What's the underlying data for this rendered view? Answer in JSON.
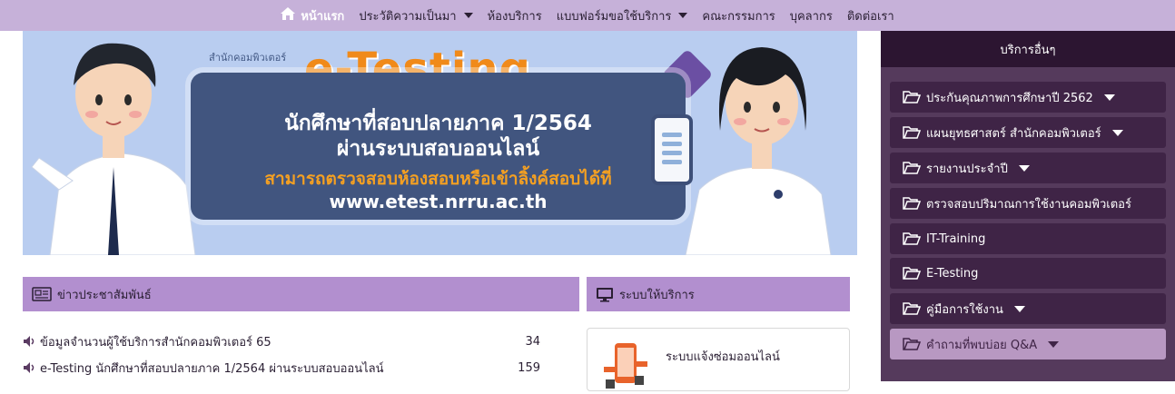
{
  "topnav": {
    "items": [
      {
        "label": "หน้าแรก",
        "icon": "home-icon",
        "dropdown": false
      },
      {
        "label": "ประวัติความเป็นมา",
        "dropdown": true
      },
      {
        "label": "ห้องบริการ",
        "dropdown": false
      },
      {
        "label": "แบบฟอร์มขอใช้บริการ",
        "dropdown": true
      },
      {
        "label": "คณะกรรมการ",
        "dropdown": false
      },
      {
        "label": "บุคลากร",
        "dropdown": false
      },
      {
        "label": "ติดต่อเรา",
        "dropdown": false
      }
    ]
  },
  "banner": {
    "org": "สำนักคอมพิวเตอร์",
    "title": "e-Testing",
    "line1": "นักศึกษาที่สอบปลายภาค 1/2564",
    "line2": "ผ่านระบบสอบออนไลน์",
    "line3": "สามารถตรวจสอบห้องสอบหรือเข้าลิ้งค์สอบได้ที่",
    "line4": "www.etest.nrru.ac.th"
  },
  "news": {
    "header": "ข่าวประชาสัมพันธ์",
    "items": [
      {
        "title": "ข้อมูลจำนวนผู้ใช้บริการสำนักคอมพิวเตอร์ 65",
        "count": "34"
      },
      {
        "title": "e-Testing นักศึกษาที่สอบปลายภาค 1/2564 ผ่านระบบสอบออนไลน์",
        "count": "159"
      }
    ]
  },
  "services": {
    "header": "ระบบให้บริการ",
    "card_label": "ระบบแจ้งซ่อมออนไลน์"
  },
  "sidebar": {
    "header": "บริการอื่นๆ",
    "items": [
      {
        "label": "ประกันคุณภาพการศึกษาปี 2562",
        "dropdown": true
      },
      {
        "label": "แผนยุทธศาสตร์ สำนักคอมพิวเตอร์",
        "dropdown": true
      },
      {
        "label": "รายงานประจำปี",
        "dropdown": true
      },
      {
        "label": "ตรวจสอบปริมาณการใช้งานคอมพิวเตอร์",
        "dropdown": false
      },
      {
        "label": "IT-Training",
        "dropdown": false
      },
      {
        "label": "E-Testing",
        "dropdown": false
      },
      {
        "label": "คู่มือการใช้งาน",
        "dropdown": true
      },
      {
        "label": "คำถามที่พบบ่อย Q&A",
        "dropdown": true
      }
    ]
  },
  "colors": {
    "nav_bg": "#c6b1d9",
    "section_header": "#b28fcf",
    "sidebar_bg": "#553a5c",
    "sidebar_head": "#2c1531",
    "sidebar_btn": "#3f2446",
    "banner_orange": "#f08a1a"
  }
}
